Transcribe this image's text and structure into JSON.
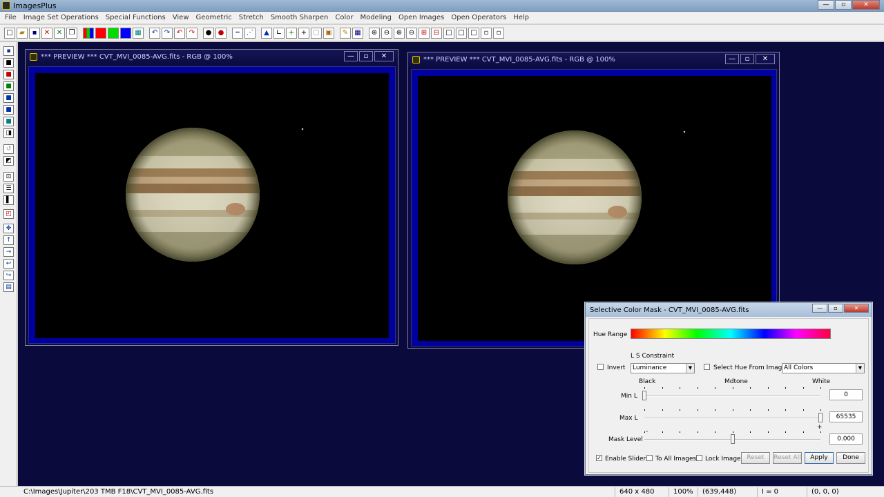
{
  "app": {
    "title": "ImagesPlus"
  },
  "menu": [
    "File",
    "Image Set Operations",
    "Special Functions",
    "View",
    "Geometric",
    "Stretch",
    "Smooth Sharpen",
    "Color",
    "Modeling",
    "Open Images",
    "Open Operators",
    "Help"
  ],
  "previews": [
    {
      "title": "*** PREVIEW *** CVT_MVI_0085-AVG.fits - RGB @ 100%"
    },
    {
      "title": "*** PREVIEW *** CVT_MVI_0085-AVG.fits - RGB @ 100%"
    }
  ],
  "dialog": {
    "title": "Selective Color Mask - CVT_MVI_0085-AVG.fits",
    "hue_range_label": "Hue Range",
    "ls_constraint_label": "L S Constraint",
    "invert_label": "Invert",
    "invert_checked": false,
    "ls_constraint_value": "Luminance",
    "select_hue_label": "Select Hue From Image",
    "select_hue_checked": false,
    "colors_value": "All Colors",
    "scale_black": "Black",
    "scale_midtone": "Mdtone",
    "scale_white": "White",
    "min_l_label": "Min L",
    "min_l_value": "0",
    "max_l_label": "Max L",
    "max_l_value": "65535",
    "mask_level_label": "Mask Level",
    "mask_level_value": "0.000",
    "mask_minus": "-",
    "mask_plus": "+",
    "enable_sliders_label": "Enable Sliders",
    "enable_sliders_checked": true,
    "to_all_images_label": "To All Images",
    "lock_image_label": "Lock Image",
    "reset_label": "Reset",
    "reset_all_label": "Reset All",
    "apply_label": "Apply",
    "done_label": "Done",
    "min_l_fraction": 0.0,
    "max_l_fraction": 1.0,
    "mask_level_fraction": 0.5
  },
  "status": {
    "path": "C:\\Images\\Jupiter\\203 TMB F18\\CVT_MVI_0085-AVG.fits",
    "dimensions": "640 x 480",
    "zoom": "100%",
    "cursor": "(639,448)",
    "intensity": "I = 0",
    "rgb": "(0, 0, 0)"
  }
}
